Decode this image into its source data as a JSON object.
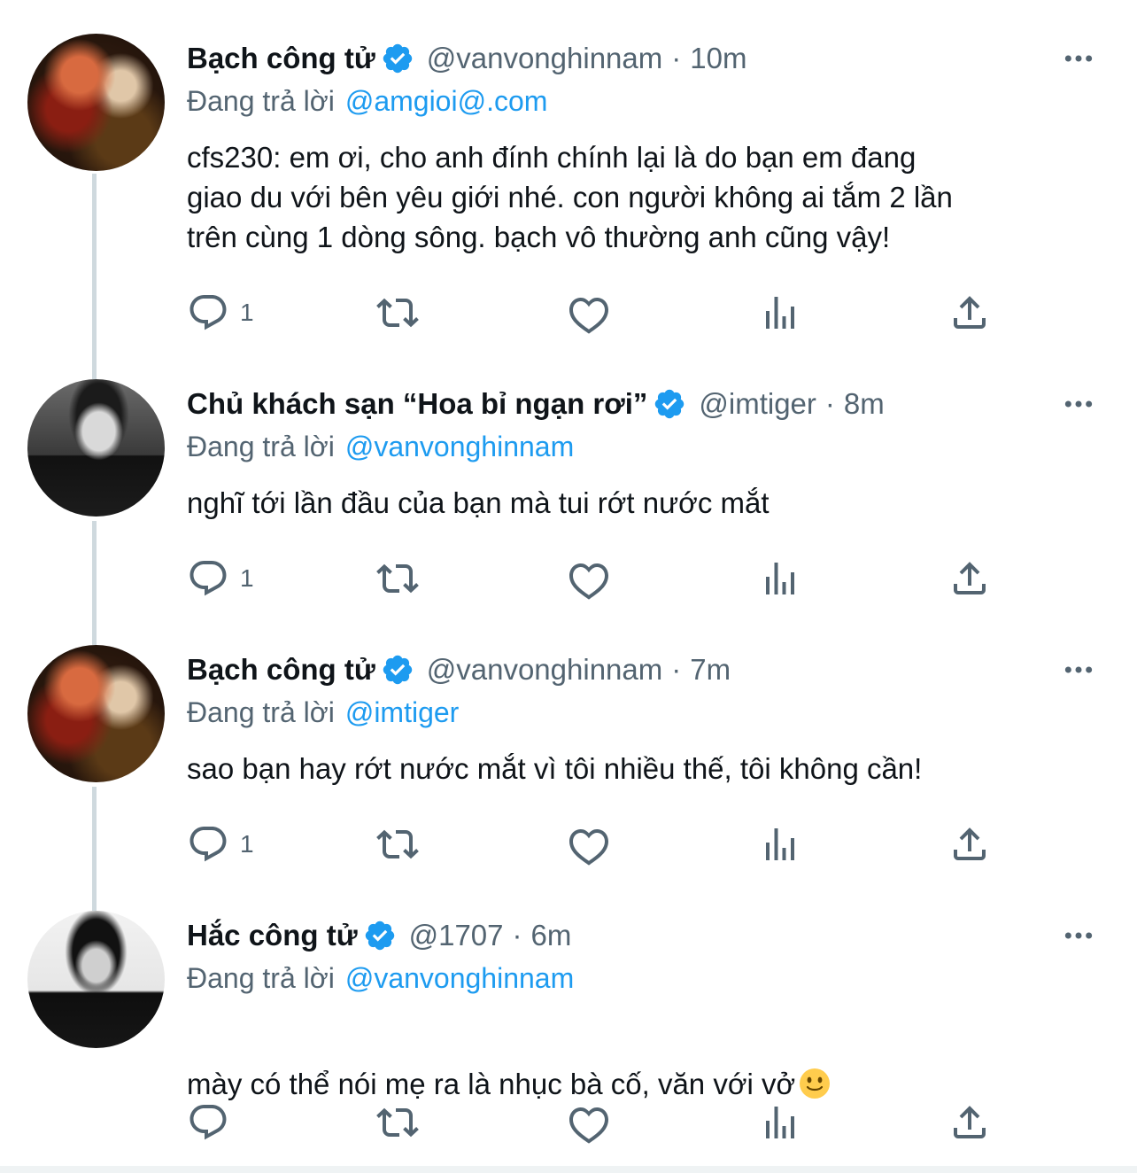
{
  "replying_prefix": "Đang trả lời",
  "tweets": [
    {
      "name": "Bạch công tử",
      "handle": "@vanvonghinnam",
      "separator": "·",
      "time": "10m",
      "reply_to": "@amgioi@.com",
      "text": "cfs230: em ơi, cho anh đính chính lại là do bạn em đang\ngiao du với bên yêu giới nhé. con người không ai tắm 2 lần\ntrên cùng 1 dòng sông. bạch vô thường anh cũng vậy!",
      "reply_count": "1"
    },
    {
      "name": "Chủ khách sạn “Hoa bỉ ngạn rơi”",
      "handle": "@imtiger",
      "separator": "·",
      "time": "8m",
      "reply_to": "@vanvonghinnam",
      "text": "nghĩ tới lần đầu của bạn mà tui rớt nước mắt",
      "reply_count": "1"
    },
    {
      "name": "Bạch công tử",
      "handle": "@vanvonghinnam",
      "separator": "·",
      "time": "7m",
      "reply_to": "@imtiger",
      "text": "sao bạn hay rớt nước mắt vì tôi nhiều thế, tôi không cần!",
      "reply_count": "1"
    },
    {
      "name": "Hắc công tử",
      "handle": "@1707",
      "separator": "·",
      "time": "6m",
      "reply_to": "@vanvonghinnam",
      "text": "mày có thể nói mẹ ra là nhục bà cố, văn với vở",
      "reply_count": ""
    }
  ],
  "icons": {
    "verified": "verified-badge-icon",
    "more": "more-options-icon",
    "reply": "reply-icon",
    "retweet": "retweet-icon",
    "like": "like-icon",
    "views": "views-icon",
    "share": "share-icon",
    "emoji": "slightly-smiling-face-emoji"
  },
  "colors": {
    "accent": "#1d9bf0",
    "secondary_text": "#536471",
    "thread_line": "#cfd9de"
  }
}
